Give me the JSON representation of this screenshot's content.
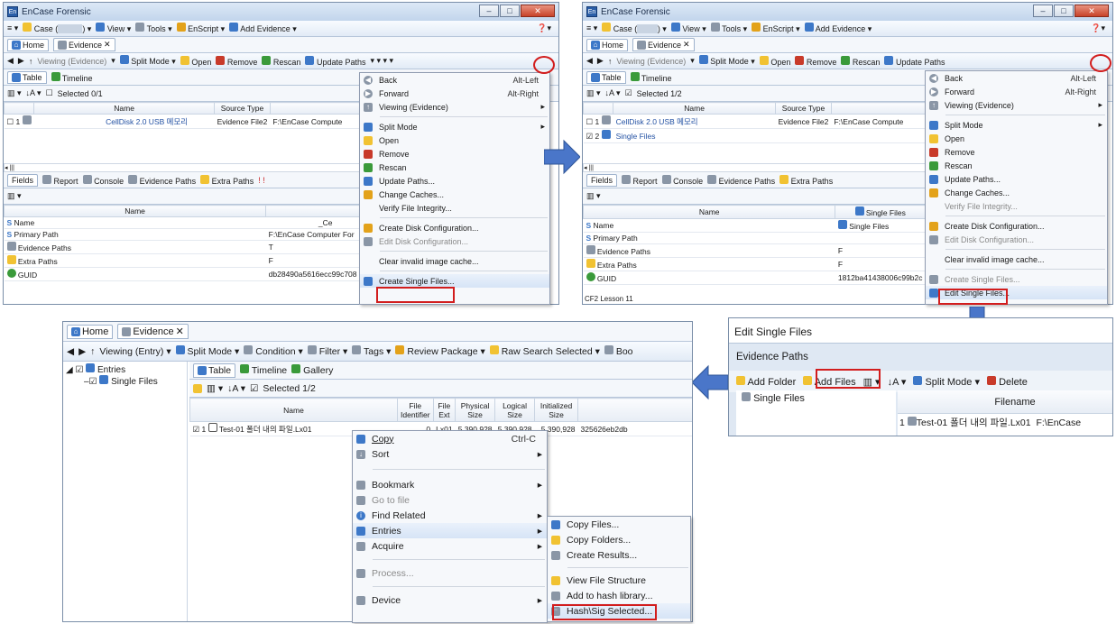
{
  "app_title": "EnCase Forensic",
  "panel1": {
    "menu_bar": [
      "Case (",
      "View",
      "Tools",
      "EnScript",
      "Add Evidence"
    ],
    "tabs": [
      "Home",
      "Evidence"
    ],
    "toolbar": [
      "Viewing (Evidence)",
      "Split Mode",
      "Open",
      "Remove",
      "Rescan",
      "Update Paths"
    ],
    "subtabs": [
      "Table",
      "Timeline"
    ],
    "selected": "Selected 0/1",
    "columns": [
      "Name",
      "Source Type"
    ],
    "row": {
      "num": "1",
      "name": "CellDisk 2.0 USB 메모리",
      "type": "Evidence File2",
      "path": "F:\\EnCase Compute"
    },
    "bottom_tabs": [
      "Fields",
      "Report",
      "Console",
      "Evidence Paths",
      "Extra Paths"
    ],
    "fields_header": "Name",
    "fields": [
      {
        "s": "S",
        "name": "Name",
        "val": "_Ce"
      },
      {
        "s": "S",
        "name": "Primary Path",
        "val": "F:\\EnCase Computer For"
      },
      {
        "s": "",
        "name": "Evidence Paths",
        "val": "T"
      },
      {
        "s": "",
        "name": "Extra Paths",
        "val": "F"
      },
      {
        "s": "",
        "name": "GUID",
        "val": "db28490a5616ecc99c708"
      }
    ]
  },
  "panel2": {
    "selected": "Selected 1/2",
    "rows": [
      {
        "num": "1",
        "name": "CellDisk 2.0 USB 메모리",
        "type": "Evidence File2",
        "path": "F:\\EnCase Compute"
      },
      {
        "num": "2",
        "name": "Single Files"
      }
    ],
    "fields_col": "Single Files",
    "fields": [
      {
        "s": "S",
        "name": "Name",
        "val": "Single Files"
      },
      {
        "s": "S",
        "name": "Primary Path",
        "val": ""
      },
      {
        "s": "",
        "name": "Evidence Paths",
        "val": "F"
      },
      {
        "s": "",
        "name": "Extra Paths",
        "val": "F"
      },
      {
        "s": "",
        "name": "GUID",
        "val": "1812ba41438006c99b2c"
      }
    ],
    "status": "CF2 Lesson 11"
  },
  "context_menu": {
    "back": "Back",
    "back_sc": "Alt-Left",
    "forward": "Forward",
    "forward_sc": "Alt-Right",
    "viewing": "Viewing (Evidence)",
    "split": "Split Mode",
    "open": "Open",
    "remove": "Remove",
    "rescan": "Rescan",
    "update": "Update Paths...",
    "change": "Change Caches...",
    "verify": "Verify File Integrity...",
    "create_disk": "Create Disk Configuration...",
    "edit_disk": "Edit Disk Configuration...",
    "clear": "Clear invalid image cache...",
    "create_single": "Create Single Files...",
    "edit_single": "Edit Single Files..."
  },
  "edit_single": {
    "title": "Edit Single Files",
    "section": "Evidence Paths",
    "add_folder": "Add Folder",
    "add_files": "Add Files",
    "split": "Split Mode",
    "delete": "Delete",
    "tree": "Single Files",
    "col": "Filename",
    "row_num": "1",
    "row_file": "Test-01 폴더 내의 파일.Lx01",
    "row_path": "F:\\EnCase"
  },
  "panel4": {
    "tabs": [
      "Home",
      "Evidence"
    ],
    "toolbar": [
      "Viewing (Entry)",
      "Split Mode",
      "Condition",
      "Filter",
      "Tags",
      "Review Package",
      "Raw Search Selected",
      "Boo"
    ],
    "tree": [
      "Entries",
      "Single Files"
    ],
    "subtabs": [
      "Table",
      "Timeline",
      "Gallery"
    ],
    "selected": "Selected 1/2",
    "columns": [
      "Name",
      "File Identifier",
      "File Ext",
      "Physical Size",
      "Logical Size",
      "Initialized Size"
    ],
    "row": {
      "num": "1",
      "name": "Test-01 폴더 내의 파일.Lx01",
      "id": "0",
      "ext": "Lx01",
      "phys": "5,390,928",
      "log": "5,390,928",
      "init": "5,390,928",
      "hash": "325626eb2db"
    },
    "menu": [
      "Copy",
      "Sort",
      "Bookmark",
      "Go to file",
      "Find Related",
      "Entries",
      "Acquire",
      "Process...",
      "Device"
    ],
    "copy_sc": "Ctrl-C",
    "submenu": [
      "Copy Files...",
      "Copy Folders...",
      "Create Results...",
      "View File Structure",
      "Add to hash library...",
      "Hash\\Sig Selected..."
    ]
  },
  "colors": {
    "accent": "#4a76c9",
    "highlight": "#d21d1d"
  }
}
